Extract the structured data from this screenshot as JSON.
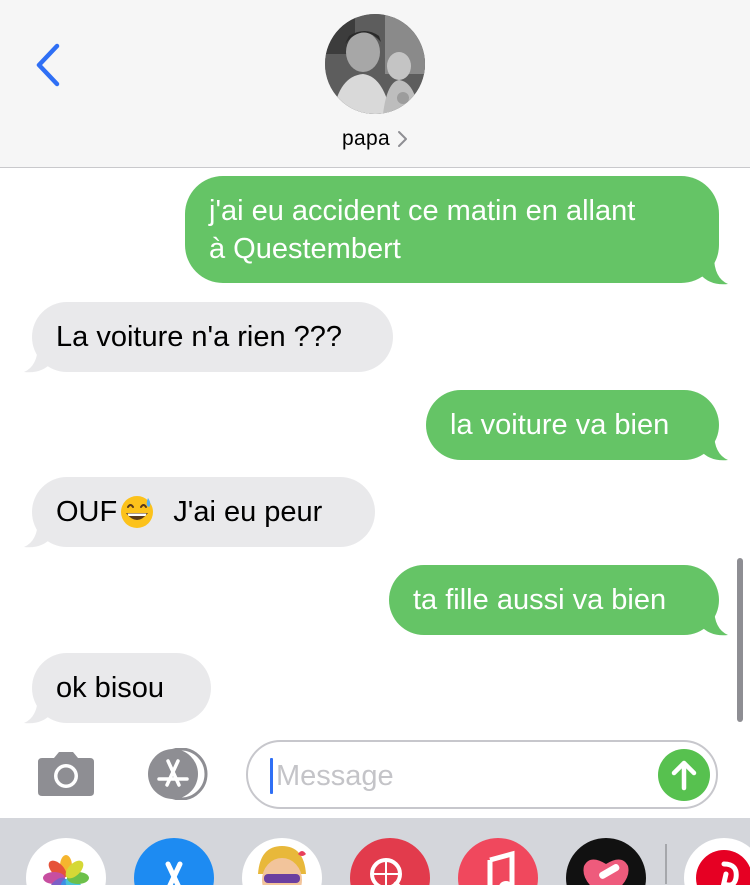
{
  "header": {
    "contact_name": "papa",
    "back_icon": "chevron-left-icon",
    "chevron_icon": "chevron-right-icon"
  },
  "messages": [
    {
      "direction": "sent",
      "lines": [
        "j'ai eu accident ce matin en allant",
        "à Questembert"
      ]
    },
    {
      "direction": "received",
      "text": "La voiture n'a rien ???"
    },
    {
      "direction": "sent",
      "text": "la voiture va bien"
    },
    {
      "direction": "received",
      "text_before": "OUF",
      "emoji": "grinning-sweat-emoji",
      "text_after": " J'ai eu peur"
    },
    {
      "direction": "sent",
      "text": "ta fille aussi va bien"
    },
    {
      "direction": "received",
      "text": "ok bisou"
    }
  ],
  "input_bar": {
    "camera_icon": "camera-icon",
    "appstore_icon": "app-store-icon",
    "placeholder": "Message",
    "send_icon": "arrow-up-icon"
  },
  "drawer": {
    "apps": [
      "photos-icon",
      "app-store-icon",
      "memoji-icon",
      "search-web-icon",
      "music-icon",
      "heart-app-icon",
      "pinterest-icon"
    ]
  },
  "colors": {
    "sent_bubble": "#65c466",
    "received_bubble": "#e9e9eb",
    "accent": "#2f6ff5",
    "send_button": "#57c14f"
  }
}
